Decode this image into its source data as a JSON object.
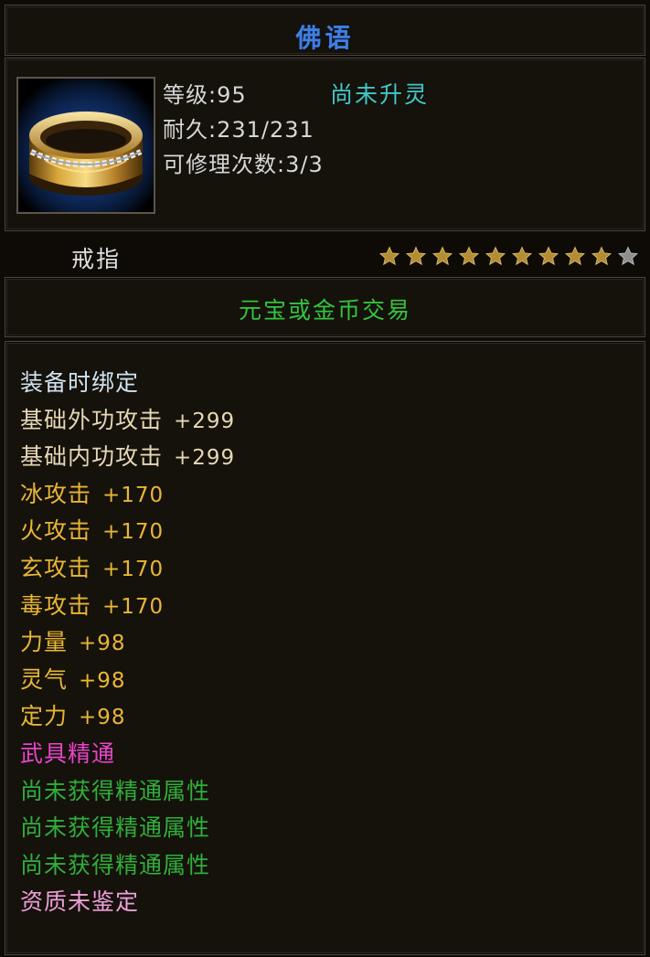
{
  "item": {
    "name": "佛语",
    "level_label": "等级:95",
    "spirit_status": "尚未升灵",
    "durability_label": "耐久:231/231",
    "repair_label": "可修理次数:3/3",
    "type": "戒指",
    "icon": "gold-ring-icon",
    "star_rating": {
      "filled": 9,
      "total": 10
    },
    "trade_rule": "元宝或金币交易"
  },
  "attributes": [
    {
      "label": "装备时绑定",
      "value": "",
      "color": "#cfe3ef"
    },
    {
      "label": "基础外功攻击",
      "value": "+299",
      "color": "#e6d7b4"
    },
    {
      "label": "基础内功攻击",
      "value": "+299",
      "color": "#e6d7b4"
    },
    {
      "label": "冰攻击",
      "value": "+170",
      "color": "#e8b634"
    },
    {
      "label": "火攻击",
      "value": "+170",
      "color": "#e8b634"
    },
    {
      "label": "玄攻击",
      "value": "+170",
      "color": "#e8b634"
    },
    {
      "label": "毒攻击",
      "value": "+170",
      "color": "#e8b634"
    },
    {
      "label": "力量",
      "value": "+98",
      "color": "#e8b634"
    },
    {
      "label": "灵气",
      "value": "+98",
      "color": "#e8b634"
    },
    {
      "label": "定力",
      "value": "+98",
      "color": "#e8b634"
    },
    {
      "label": "武具精通",
      "value": "",
      "color": "#e645c8"
    },
    {
      "label": "尚未获得精通属性",
      "value": "",
      "color": "#2fae3a"
    },
    {
      "label": "尚未获得精通属性",
      "value": "",
      "color": "#2fae3a"
    },
    {
      "label": "尚未获得精通属性",
      "value": "",
      "color": "#2fae3a"
    },
    {
      "label": "资质未鉴定",
      "value": "",
      "color": "#ef9fd9"
    }
  ],
  "colors": {
    "title": "#3f7fe0",
    "spirit": "#3fc8c8",
    "trade": "#34c43c",
    "star_filled": "#b48c34",
    "star_empty": "#8e8e8e"
  }
}
